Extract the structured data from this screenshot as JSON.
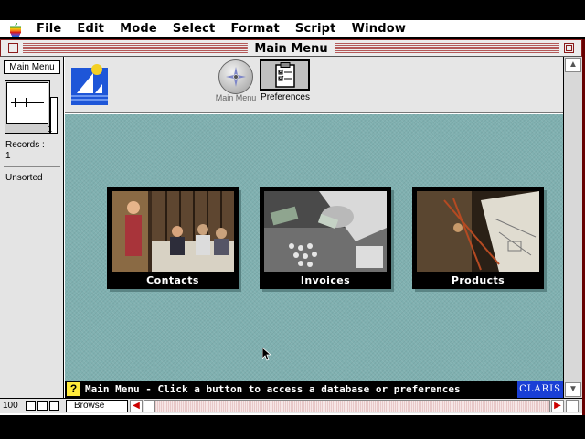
{
  "menubar": {
    "items": [
      "File",
      "Edit",
      "Mode",
      "Select",
      "Format",
      "Script",
      "Window"
    ]
  },
  "window": {
    "title": "Main Menu"
  },
  "status_area": {
    "layout_name": "Main Menu",
    "book_page": "1",
    "records_label": "Records :",
    "records_count": "1",
    "sort_status": "Unsorted"
  },
  "header": {
    "main_menu_label": "Main Menu",
    "preferences_label": "Preferences"
  },
  "tiles": [
    {
      "label": "Contacts"
    },
    {
      "label": "Invoices"
    },
    {
      "label": "Products"
    }
  ],
  "footer": {
    "help_symbol": "?",
    "message": "Main Menu - Click a button to access a database or preferences",
    "brand": "CLARIS"
  },
  "bottom_bar": {
    "zoom": "100",
    "mode": "Browse"
  },
  "colors": {
    "body_background": "#7fb0b0",
    "footer_background": "#000000",
    "brand_background": "#1a3fd6",
    "help_icon": "#ffeb3b"
  }
}
